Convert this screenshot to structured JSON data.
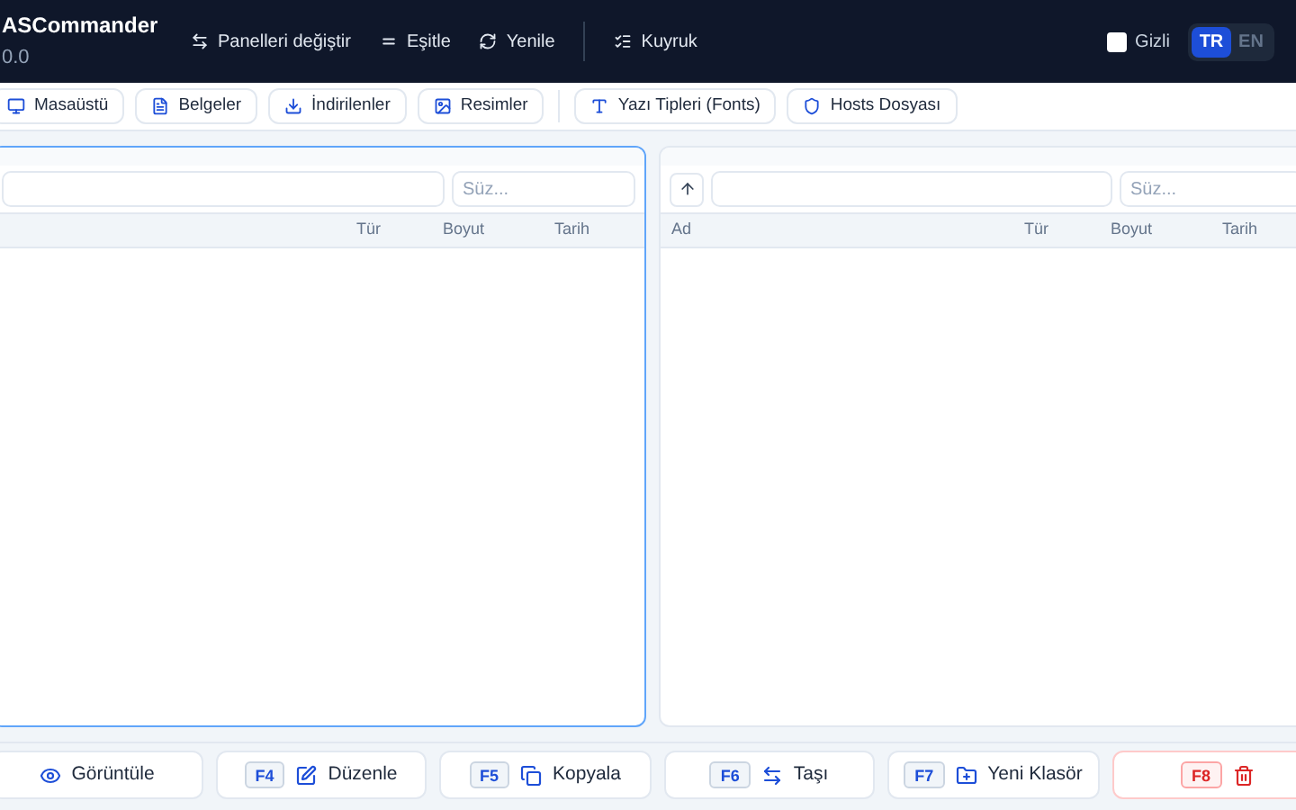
{
  "app": {
    "title": "ASCommander",
    "version": "0.0"
  },
  "nav": [
    {
      "label": "Panelleri değiştir"
    },
    {
      "label": "Eşitle"
    },
    {
      "label": "Yenile"
    },
    {
      "label": "Kuyruk"
    }
  ],
  "hidden_toggle": {
    "label": "Gizli",
    "checked": false
  },
  "languages": [
    {
      "label": "TR",
      "selected": true
    },
    {
      "label": "EN",
      "selected": false
    }
  ],
  "places": [
    {
      "label": "Masaüstü"
    },
    {
      "label": "Belgeler"
    },
    {
      "label": "İndirilenler"
    },
    {
      "label": "Resimler"
    },
    {
      "label": "Yazı Tipleri (Fonts)"
    },
    {
      "label": "Hosts Dosyası"
    }
  ],
  "panels": [
    {
      "active": true,
      "up_button": false,
      "filter_placeholder": "Süz...",
      "columns": [
        "Tür",
        "Boyut",
        "Tarih"
      ]
    },
    {
      "active": false,
      "up_button": true,
      "filter_placeholder": "Süz...",
      "columns": [
        "Ad",
        "Tür",
        "Boyut",
        "Tarih"
      ]
    }
  ],
  "function_keys": [
    {
      "label": "Görüntüle",
      "kind": "normal"
    },
    {
      "key": "F4",
      "label": "Düzenle",
      "kind": "normal"
    },
    {
      "key": "F5",
      "label": "Kopyala",
      "kind": "normal"
    },
    {
      "key": "F6",
      "label": "Taşı",
      "kind": "normal"
    },
    {
      "key": "F7",
      "label": "Yeni Klasör",
      "kind": "normal"
    },
    {
      "key": "F8",
      "kind": "danger"
    }
  ]
}
